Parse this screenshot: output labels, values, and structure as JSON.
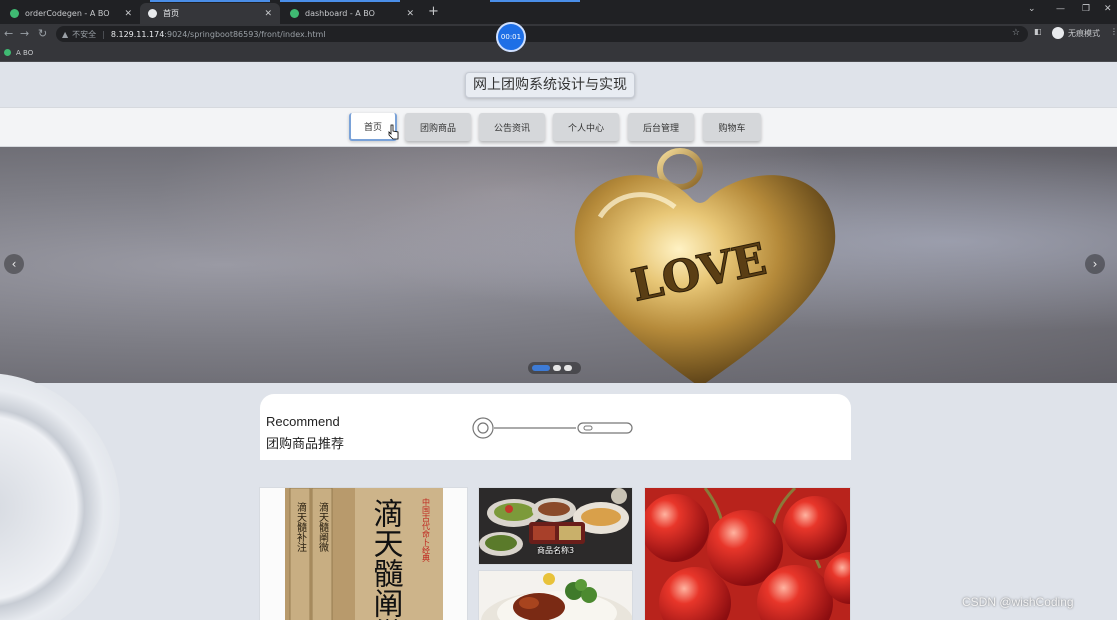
{
  "browser": {
    "tabs": [
      {
        "title": "orderCodegen - A BO",
        "active": false
      },
      {
        "title": "首页",
        "active": true
      },
      {
        "title": "dashboard - A BO",
        "active": false
      }
    ],
    "new_tab": "+",
    "address": {
      "security": "不安全",
      "host": "8.129.11.174",
      "path": ":9024/springboot86593/front/index.html"
    },
    "profile_label": "无痕模式",
    "bookmark": "A BO",
    "recording_time": "00:01"
  },
  "site": {
    "title": "网上团购系统设计与实现",
    "nav": [
      {
        "label": "首页",
        "active": true
      },
      {
        "label": "团购商品",
        "active": false
      },
      {
        "label": "公告资讯",
        "active": false
      },
      {
        "label": "个人中心",
        "active": false
      },
      {
        "label": "后台管理",
        "active": false
      },
      {
        "label": "购物车",
        "active": false
      }
    ],
    "banner": {
      "image_text": "LOVE",
      "slides": 3,
      "active_slide": 1
    },
    "recommend": {
      "title_en": "Recommend",
      "title_cn": "团购商品推荐"
    },
    "products": [
      {
        "book_title": "滴天髓阐微",
        "vertical_red": "中国古代命卜经典",
        "spine_1": "滴天髓阐微",
        "spine_2": "滴天髓补注"
      },
      {
        "label": "商品名称3"
      },
      {
        "label": ""
      },
      {
        "label": ""
      }
    ]
  },
  "watermark": "CSDN @wishCoding"
}
